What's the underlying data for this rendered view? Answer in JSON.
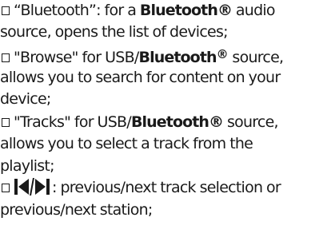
{
  "items": [
    {
      "lead": "“Bluetooth”: for a ",
      "bold": "Bluetooth®",
      "rest_line1": " audio",
      "line2": "source, opens the list of devices;"
    },
    {
      "lead": "\"Browse\" for USB/",
      "bold": "Bluetooth",
      "reg": "®",
      "rest_line1": " source,",
      "line2": "allows you to search for content on your",
      "line3": "device;"
    },
    {
      "lead": "\"Tracks\" for USB/",
      "bold": "Bluetooth®",
      "rest_line1": " source,",
      "line2": "allows you to select a track from the",
      "line3": "playlist;"
    },
    {
      "icon": "previous-next-track-icon",
      "rest_line1": ": previous/next track selection or",
      "line2": "previous/next station;"
    }
  ]
}
